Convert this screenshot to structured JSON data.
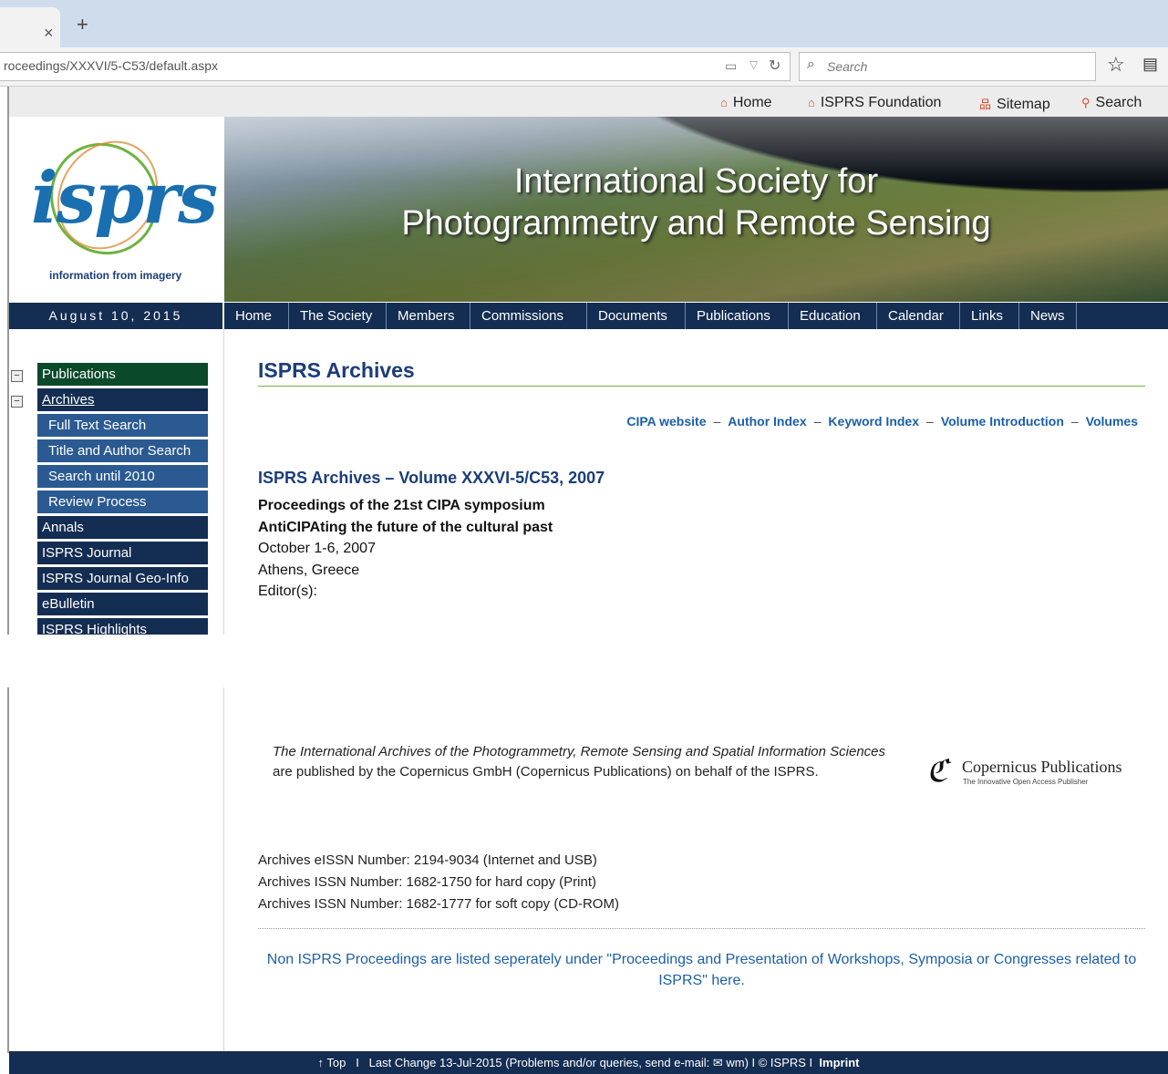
{
  "browser": {
    "tab_close": "×",
    "new_tab": "+",
    "url": "roceedings/XXXVI/5-C53/default.aspx",
    "search_placeholder": "Search"
  },
  "util_links": [
    "Home",
    "ISPRS Foundation",
    "Sitemap",
    "Search"
  ],
  "logo": {
    "text": "isprs",
    "tagline": "information from imagery"
  },
  "banner": {
    "line1": "International Society for",
    "line2": "Photogrammetry and Remote Sensing"
  },
  "date": "August 10, 2015",
  "nav": [
    "Home",
    "The Society",
    "Members",
    "Commissions",
    "Documents",
    "Publications",
    "Education",
    "Calendar",
    "Links",
    "News"
  ],
  "sidebar": {
    "items": [
      {
        "label": "Publications"
      },
      {
        "label": "Archives"
      },
      {
        "label": "Full Text Search"
      },
      {
        "label": "Title and Author Search"
      },
      {
        "label": "Search until 2010"
      },
      {
        "label": "Review Process"
      },
      {
        "label": "Annals"
      },
      {
        "label": "ISPRS Journal"
      },
      {
        "label": "ISPRS Journal Geo-Info"
      },
      {
        "label": "eBulletin"
      },
      {
        "label": "ISPRS Highlights"
      }
    ]
  },
  "main": {
    "title": "ISPRS Archives",
    "sublinks": [
      "CIPA website",
      "Author Index",
      "Keyword Index",
      "Volume Introduction",
      "Volumes"
    ],
    "sublink_sep": "–",
    "volume_title": "ISPRS Archives – Volume XXXVI-5/C53, 2007",
    "proc_line1": "Proceedings of the 21st CIPA symposium",
    "proc_line2": "AntiCIPAting the future of the cultural past",
    "dates": "October 1-6, 2007",
    "location": "Athens, Greece",
    "editors": "Editor(s):"
  },
  "publisher": {
    "italic": "The International Archives of the Photogrammetry, Remote Sensing and Spatial Information Sciences",
    "rest": " are published by the Copernicus GmbH (Copernicus Publications) on behalf of the ISPRS.",
    "logo_name": "Copernicus Publications",
    "logo_tag": "The Innovative Open Access Publisher"
  },
  "issn": [
    "Archives eISSN Number: 2194-9034 (Internet and USB)",
    "Archives ISSN Number: 1682-1750 for hard copy (Print)",
    "Archives ISSN Number: 1682-1777 for soft copy (CD-ROM)"
  ],
  "non_isprs": "Non ISPRS Proceedings are listed seperately under \"Proceedings and Presentation of Workshops, Symposia or Congresses related to ISPRS\" here.",
  "footer": {
    "top": "↑ Top",
    "sep": "I",
    "change": "Last Change 13-Jul-2015 (Problems and/or queries, send e-mail: ✉ wm) I © ISPRS I",
    "imprint": "Imprint"
  },
  "colors": {
    "navy": "#142d52",
    "accent_green": "#6db33f",
    "link_blue": "#1b5fa8"
  }
}
